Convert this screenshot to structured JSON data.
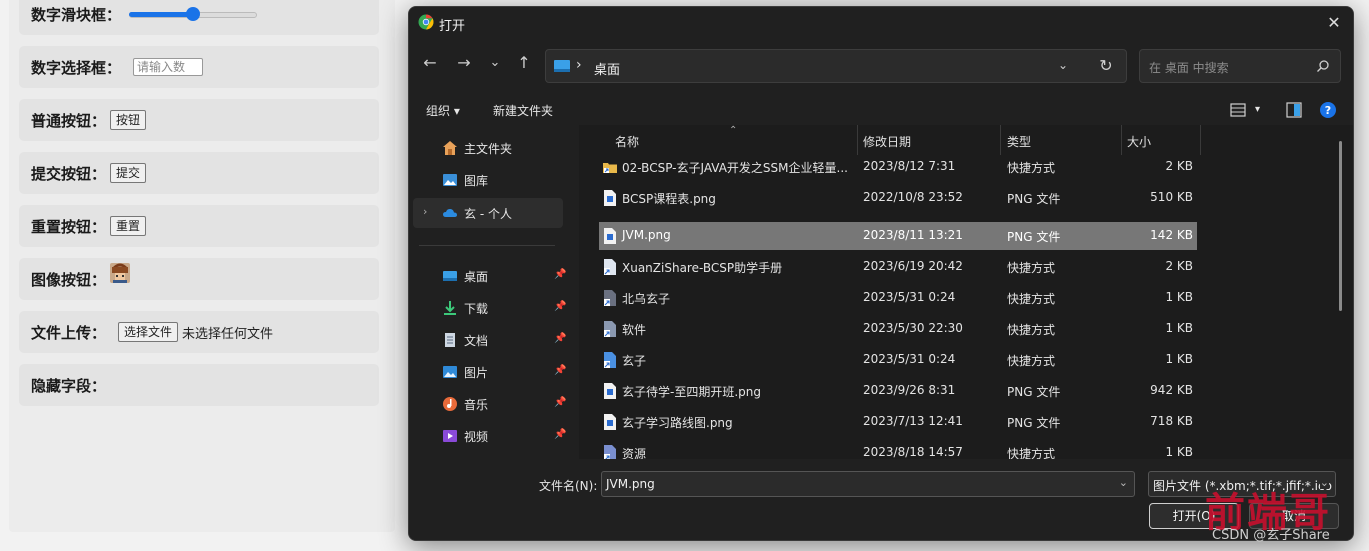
{
  "form": {
    "range_label": "数字滑块框：",
    "range_value": 0.5,
    "number_label": "数字选择框：",
    "number_placeholder": "请输入数",
    "button_label": "普通按钮：",
    "button_text": "按钮",
    "submit_label": "提交按钮：",
    "submit_text": "提交",
    "reset_label": "重置按钮：",
    "reset_text": "重置",
    "image_label": "图像按钮：",
    "file_label": "文件上传：",
    "file_button": "选择文件",
    "file_status": "未选择任何文件",
    "hidden_label": "隐藏字段："
  },
  "dialog": {
    "title": "打开",
    "close": "✕",
    "nav": {
      "back": "←",
      "forward": "→",
      "recent": "⌄",
      "up": "↑"
    },
    "address": {
      "sep": "›",
      "location": "桌面"
    },
    "search_placeholder": "在 桌面 中搜索",
    "toolbar": {
      "organize": "组织 ▾",
      "new_folder": "新建文件夹"
    },
    "nav_pane": [
      {
        "label": "主文件夹",
        "icon": "home-icon",
        "pinned": false
      },
      {
        "label": "图库",
        "icon": "gallery-icon",
        "pinned": false
      },
      {
        "label": "玄 - 个人",
        "icon": "cloud-icon",
        "pinned": false,
        "selected": true
      },
      {
        "label": "桌面",
        "icon": "desktop-icon",
        "pinned": true
      },
      {
        "label": "下载",
        "icon": "download-icon",
        "pinned": true
      },
      {
        "label": "文档",
        "icon": "document-icon",
        "pinned": true
      },
      {
        "label": "图片",
        "icon": "picture-icon",
        "pinned": true
      },
      {
        "label": "音乐",
        "icon": "music-icon",
        "pinned": true
      },
      {
        "label": "视频",
        "icon": "video-icon",
        "pinned": true
      }
    ],
    "columns": {
      "name": "名称",
      "date": "修改日期",
      "type": "类型",
      "size": "大小"
    },
    "files": [
      {
        "name": "02-BCSP-玄子JAVA开发之SSM企业轻量...",
        "date": "2023/8/12 7:31",
        "type": "快捷方式",
        "size": "2 KB",
        "icon": "folder-shortcut-icon"
      },
      {
        "name": "BCSP课程表.png",
        "date": "2022/10/8 23:52",
        "type": "PNG 文件",
        "size": "510 KB",
        "icon": "png-file-icon"
      },
      {
        "name": "JVM.png",
        "date": "2023/8/11 13:21",
        "type": "PNG 文件",
        "size": "142 KB",
        "icon": "png-file-icon",
        "selected": true
      },
      {
        "name": "XuanZiShare-BCSP助学手册",
        "date": "2023/6/19 20:42",
        "type": "快捷方式",
        "size": "2 KB",
        "icon": "shortcut-icon"
      },
      {
        "name": "北乌玄子",
        "date": "2023/5/31 0:24",
        "type": "快捷方式",
        "size": "1 KB",
        "icon": "shortcut-icon"
      },
      {
        "name": "软件",
        "date": "2023/5/30 22:30",
        "type": "快捷方式",
        "size": "1 KB",
        "icon": "shortcut-icon"
      },
      {
        "name": "玄子",
        "date": "2023/5/31 0:24",
        "type": "快捷方式",
        "size": "1 KB",
        "icon": "shortcut-icon"
      },
      {
        "name": "玄子待学-至四期开班.png",
        "date": "2023/9/26 8:31",
        "type": "PNG 文件",
        "size": "942 KB",
        "icon": "png-file-icon"
      },
      {
        "name": "玄子学习路线图.png",
        "date": "2023/7/13 12:41",
        "type": "PNG 文件",
        "size": "718 KB",
        "icon": "png-file-icon"
      },
      {
        "name": "资源",
        "date": "2023/8/18 14:57",
        "type": "快捷方式",
        "size": "1 KB",
        "icon": "shortcut-icon"
      }
    ],
    "filename_label": "文件名(N):",
    "filename_value": "JVM.png",
    "filetype_value": "图片文件 (*.xbm;*.tif;*.jfif;*.ico",
    "open_button": "打开(O)",
    "cancel_button": "取消"
  },
  "watermark": {
    "big": "前端哥",
    "small": "CSDN @玄子Share"
  },
  "colors": {
    "accent": "#1a73e8",
    "dialog_bg": "#202020",
    "selected_row": "#777777",
    "watermark": "#c8102e"
  }
}
